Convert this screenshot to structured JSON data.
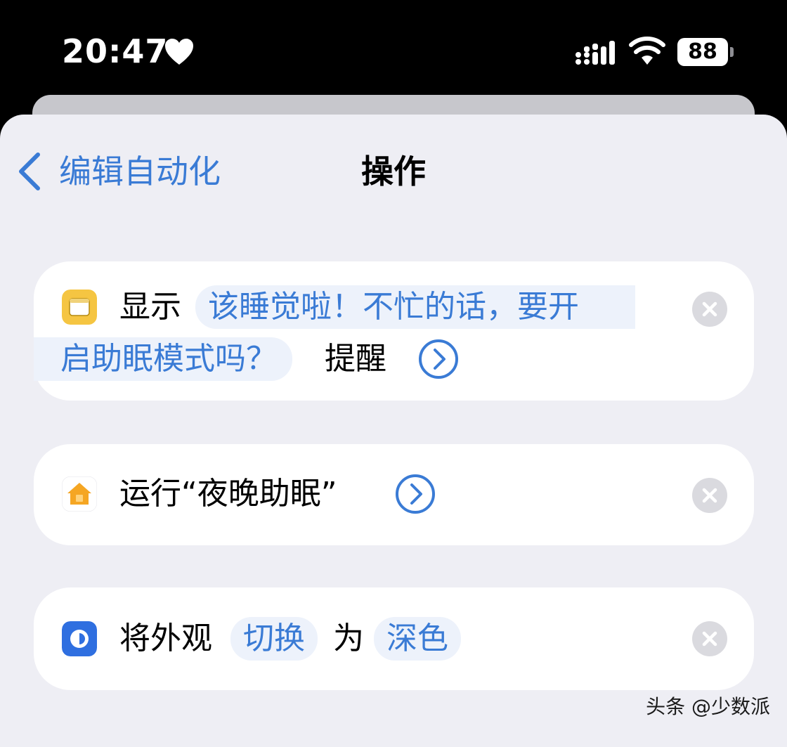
{
  "status_bar": {
    "time": "20:47",
    "battery": "88"
  },
  "nav": {
    "back_label": "编辑自动化",
    "title": "操作"
  },
  "actions": [
    {
      "verb": "显示",
      "message_line1": "该睡觉啦！不忙的话，要开",
      "message_line2": "启助眠模式吗？",
      "suffix": "提醒",
      "icon": "alert-app-icon"
    },
    {
      "text": "运行“夜晚助眠”",
      "icon": "home-app-icon"
    },
    {
      "verb": "将外观",
      "mode": "切换",
      "connector": "为",
      "value": "深色",
      "icon": "appearance-icon"
    }
  ],
  "watermark": "头条 @少数派",
  "colors": {
    "accent": "#3a7bd5",
    "background": "#eeeef4",
    "card": "#ffffff",
    "alert_icon": "#f5c542",
    "appearance_icon": "#2f6fe0"
  }
}
